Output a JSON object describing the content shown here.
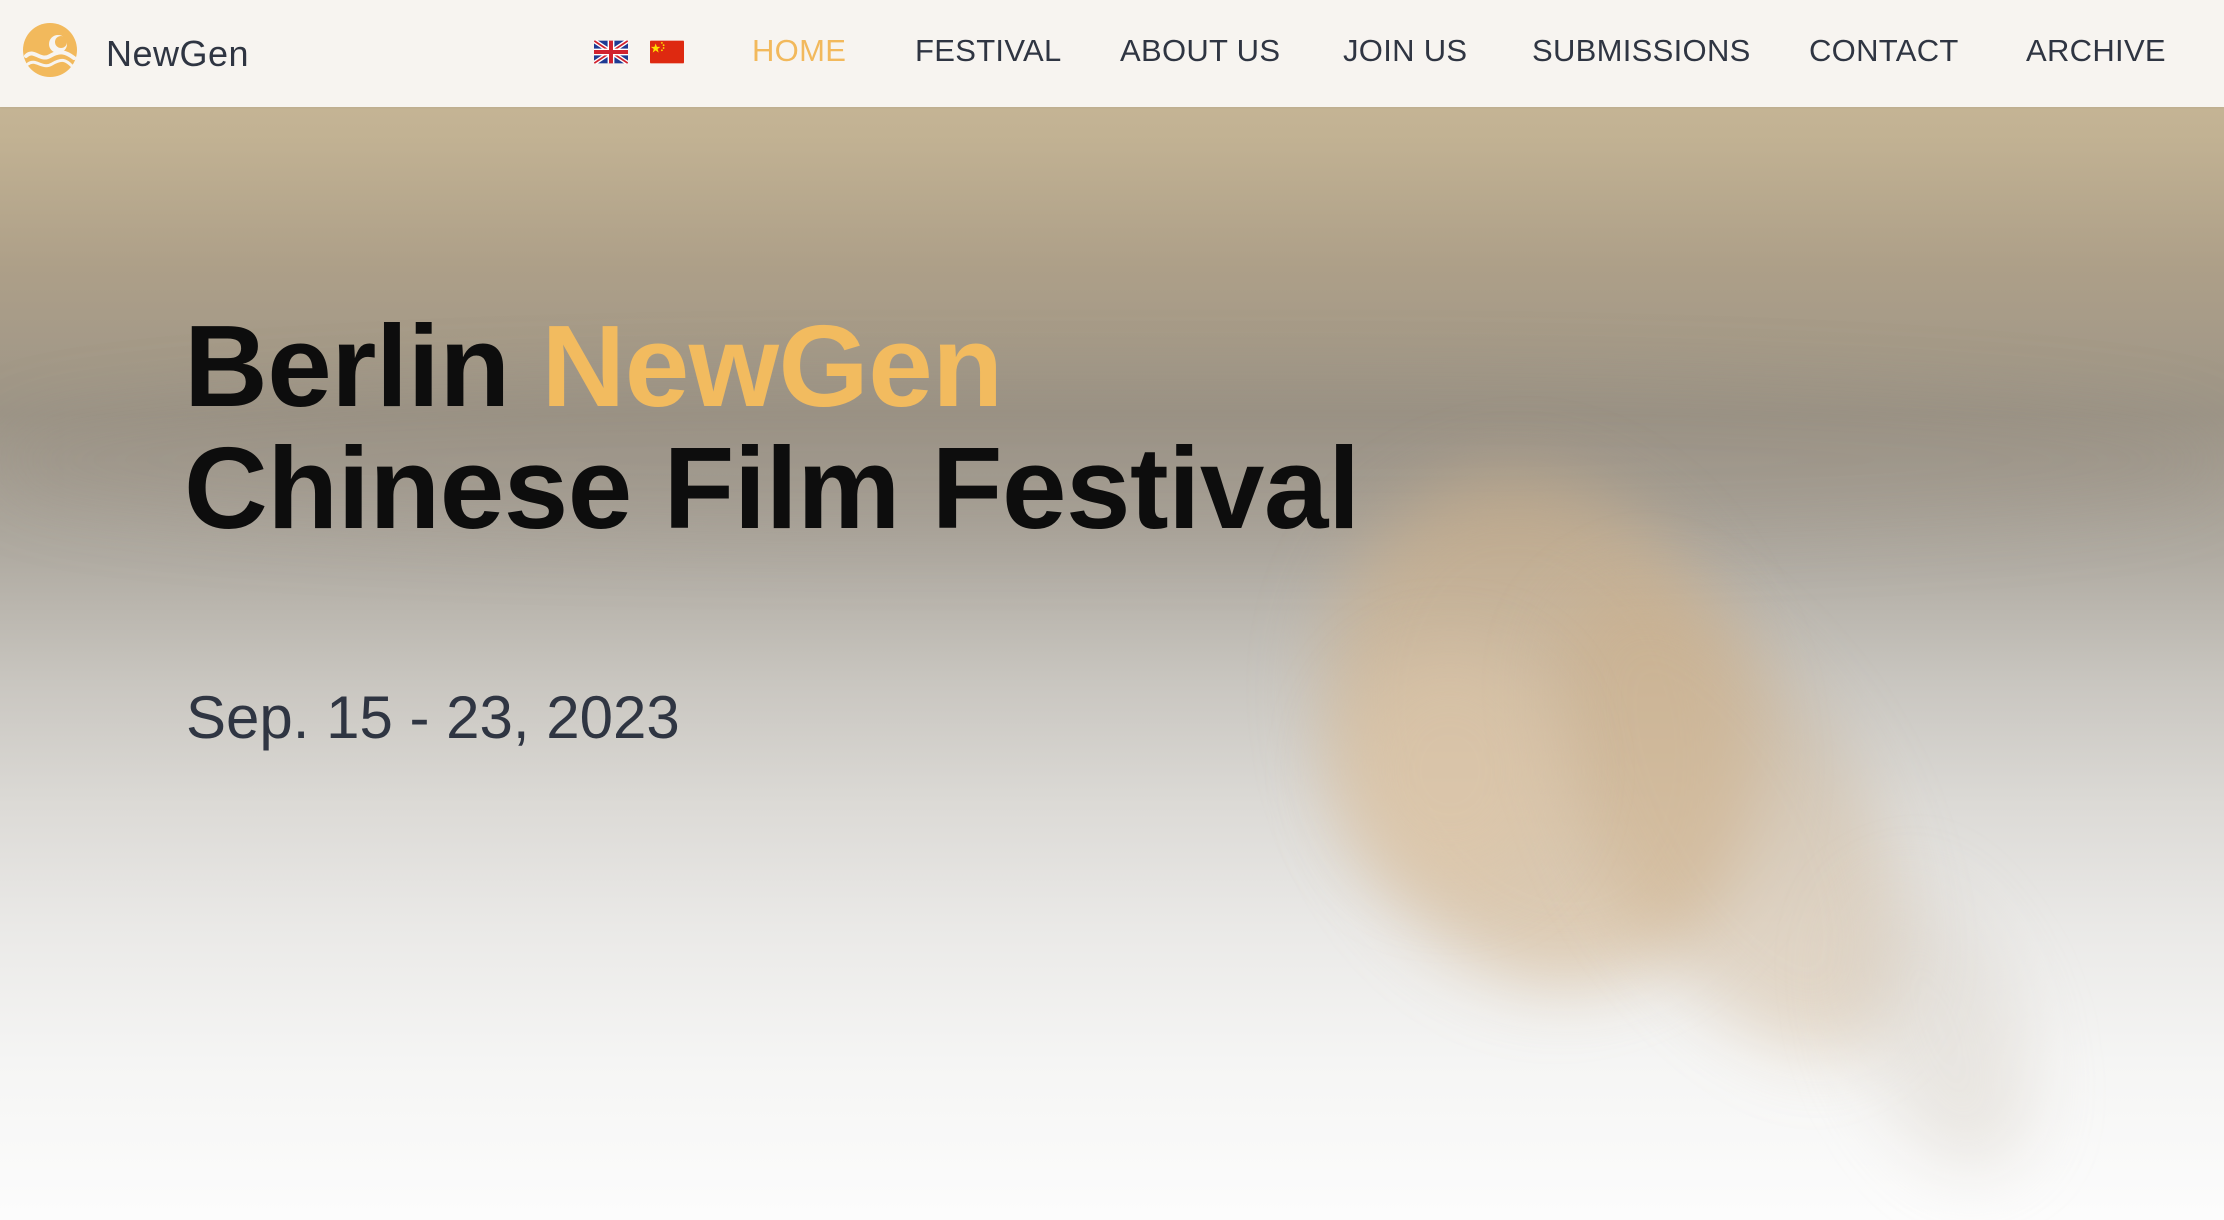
{
  "brand": {
    "name": "NewGen",
    "logo_icon": "wave-moon-logo-icon",
    "accent_color": "#f2b95c"
  },
  "languages": [
    {
      "code": "en",
      "icon": "uk-flag-icon"
    },
    {
      "code": "zh",
      "icon": "china-flag-icon"
    }
  ],
  "nav": {
    "items": [
      {
        "label": "HOME",
        "active": true
      },
      {
        "label": "FESTIVAL"
      },
      {
        "label": "ABOUT US"
      },
      {
        "label": "JOIN US"
      },
      {
        "label": "SUBMISSIONS"
      },
      {
        "label": "CONTACT"
      },
      {
        "label": "ARCHIVE"
      }
    ],
    "text_color": "#2f3542",
    "active_color": "#f2b95c"
  },
  "hero": {
    "title_part1": "Berlin",
    "title_accent": "NewGen",
    "title_line2": "Chinese Film Festival",
    "dates": "Sep. 15 - 23, 2023"
  }
}
